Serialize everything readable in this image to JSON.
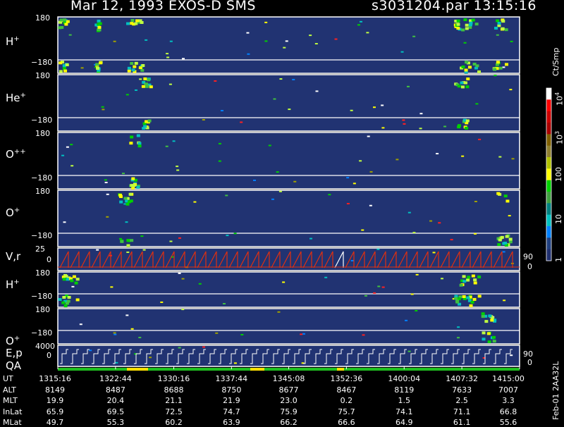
{
  "header": {
    "title_left": "Mar 12, 1993   EXOS-D SMS",
    "title_right": "s3031204.par  13:15:16"
  },
  "colorbar": {
    "unit": "Ct/Smp",
    "labels": [
      "10",
      "10",
      "100",
      "10",
      "1"
    ],
    "exponents": [
      "4",
      "3"
    ],
    "colors": [
      "#ffffff",
      "#ff0000",
      "#cc0000",
      "#aa0000",
      "#806000",
      "#908030",
      "#b0c000",
      "#ffff00",
      "#00d000",
      "#40a040",
      "#008080",
      "#00c0c0",
      "#0080ff",
      "#204080",
      "#203070"
    ]
  },
  "panels": [
    {
      "label": "H",
      "sup": "+",
      "top_tick": "180",
      "bottom_tick": "−180"
    },
    {
      "label": "He",
      "sup": "+",
      "top_tick": "180",
      "bottom_tick": "−180"
    },
    {
      "label": "O",
      "sup": "++",
      "top_tick": "180",
      "bottom_tick": "−180"
    },
    {
      "label": "O",
      "sup": "+",
      "top_tick": "180",
      "bottom_tick": "−180"
    },
    {
      "label": "V,r",
      "sup": "",
      "top_tick": "25",
      "bottom_tick": "0",
      "right_top": "90",
      "right_bottom": "0"
    },
    {
      "label": "H",
      "sup": "+",
      "top_tick": "180",
      "bottom_tick": "−180"
    },
    {
      "label": "O",
      "sup": "+",
      "top_tick": "180",
      "bottom_tick": "−180"
    },
    {
      "label": "E,p",
      "label2": "QA",
      "sup": "",
      "top_tick": "4000",
      "bottom_tick": "0",
      "right_top": "90",
      "right_bottom": "0"
    }
  ],
  "footer": {
    "rows": [
      {
        "name": "UT",
        "values": [
          "1315:16",
          "1322:44",
          "1330:16",
          "1337:44",
          "1345:08",
          "1352:36",
          "1400:04",
          "1407:32",
          "1415:00"
        ]
      },
      {
        "name": "ALT",
        "values": [
          "8149",
          "8487",
          "8688",
          "8750",
          "8677",
          "8467",
          "8119",
          "7633",
          "7007"
        ]
      },
      {
        "name": "MLT",
        "values": [
          "19.9",
          "20.4",
          "21.1",
          "21.9",
          "23.0",
          "0.2",
          "1.5",
          "2.5",
          "3.3"
        ]
      },
      {
        "name": "InLat",
        "values": [
          "65.9",
          "69.5",
          "72.5",
          "74.7",
          "75.9",
          "75.7",
          "74.1",
          "71.1",
          "66.8"
        ]
      },
      {
        "name": "MLat",
        "values": [
          "49.7",
          "55.3",
          "60.2",
          "63.9",
          "66.2",
          "66.6",
          "64.9",
          "61.1",
          "55.6"
        ]
      }
    ],
    "stamp": "Feb-01 2AA32L"
  },
  "chart_data": {
    "type": "heatmap",
    "title": "Mar 12, 1993   EXOS-D SMS",
    "x": [
      "1315:16",
      "1322:44",
      "1330:16",
      "1337:44",
      "1345:08",
      "1352:36",
      "1400:04",
      "1407:32",
      "1415:00"
    ],
    "series": [
      {
        "name": "H+",
        "ylim": [
          -180,
          180
        ],
        "hot_spans": [
          [
            "1315:16",
            "1317:00"
          ],
          [
            "1320:00",
            "1321:00"
          ],
          [
            "1324:00",
            "1326:30"
          ],
          [
            "1406:30",
            "1410:00"
          ],
          [
            "1411:30",
            "1413:30"
          ]
        ]
      },
      {
        "name": "He+",
        "ylim": [
          -180,
          180
        ],
        "hot_spans": [
          [
            "1326:00",
            "1327:30"
          ],
          [
            "1406:30",
            "1408:30"
          ]
        ]
      },
      {
        "name": "O++",
        "ylim": [
          -180,
          180
        ],
        "hot_spans": [
          [
            "1324:30",
            "1326:00"
          ]
        ]
      },
      {
        "name": "O+",
        "ylim": [
          -180,
          180
        ],
        "hot_spans": [
          [
            "1323:00",
            "1325:00"
          ],
          [
            "1412:00",
            "1414:00"
          ]
        ]
      },
      {
        "name": "V,r",
        "ylim": [
          0,
          25
        ],
        "right_ylim": [
          0,
          90
        ]
      },
      {
        "name": "H+",
        "ylim": [
          -180,
          180
        ],
        "hot_spans": [
          [
            "1315:16",
            "1318:00"
          ],
          [
            "1406:30",
            "1410:00"
          ]
        ]
      },
      {
        "name": "O+",
        "ylim": [
          -180,
          180
        ],
        "hot_spans": [
          [
            "1410:00",
            "1412:00"
          ]
        ]
      },
      {
        "name": "E,p",
        "ylim": [
          0,
          4000
        ],
        "right_ylim": [
          0,
          90
        ]
      }
    ],
    "color_scale": {
      "log": true,
      "range": [
        1,
        10000
      ],
      "unit": "Ct/Smp"
    }
  }
}
